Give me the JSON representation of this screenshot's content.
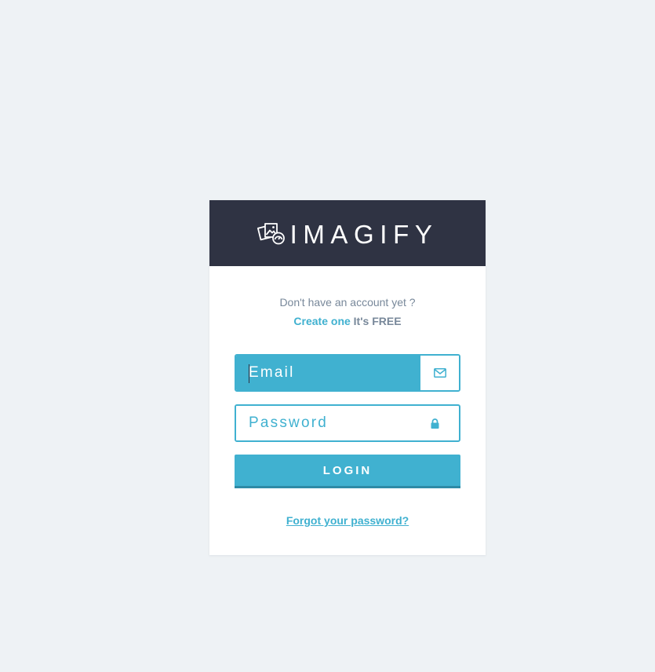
{
  "colors": {
    "page_background": "#eef2f5",
    "header_background": "#2f3343",
    "accent": "#40b1d0",
    "accent_dark": "#2e8ba6",
    "muted_text": "#78889a"
  },
  "header": {
    "logo_icon": "imagify-photos-icon",
    "brand_name": "IMAGIFY"
  },
  "signup_prompt": {
    "question": "Don't have an account yet ?",
    "create_link": "Create one",
    "free_text": "It's FREE"
  },
  "form": {
    "email": {
      "placeholder": "Email",
      "value": "",
      "icon": "envelope-icon"
    },
    "password": {
      "placeholder": "Password",
      "value": "",
      "icon": "lock-icon"
    },
    "login_label": "LOGIN",
    "forgot_link": "Forgot your password?"
  }
}
